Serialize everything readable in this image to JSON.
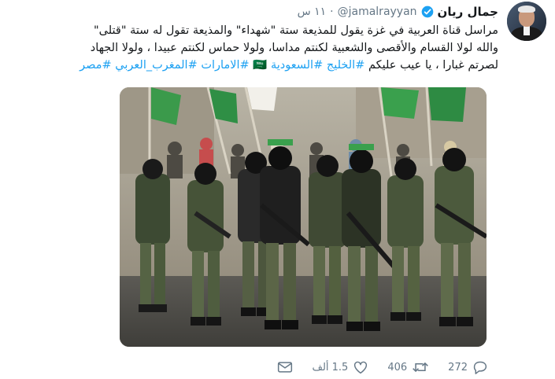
{
  "tweet": {
    "author_name": "جمال ريان",
    "handle": "@jamalrayyan",
    "separator": "·",
    "time": "١١ س",
    "lines": [
      "مراسل قناة العربية في غزة يقول للمذيعة ستة \"شهداء\" والمذيعة تقول له ستة \"قتلى\"",
      "والله لولا القسام والأقصى والشعبية لكنتم مداسا، ولولا حماس لكنتم عبيدا ، ولولا الجهاد",
      "لصرتم غبارا ،"
    ],
    "line3_plain": "يا عيب عليكم",
    "hashtags": [
      "#الخليج",
      "#السعودية",
      "#الامارات",
      "#المغرب_العربي",
      "#مصر"
    ],
    "hashtag_flag_glyph": "🇸🇦"
  },
  "stats": {
    "replies": "272",
    "retweets": "406",
    "likes": "1.5 ألف"
  },
  "colors": {
    "link": "#1da1f2",
    "muted": "#657786",
    "text": "#14171a",
    "verified": "#1da1f2"
  },
  "icons": [
    "verified-icon",
    "reply-icon",
    "retweet-icon",
    "like-icon",
    "dm-icon"
  ]
}
